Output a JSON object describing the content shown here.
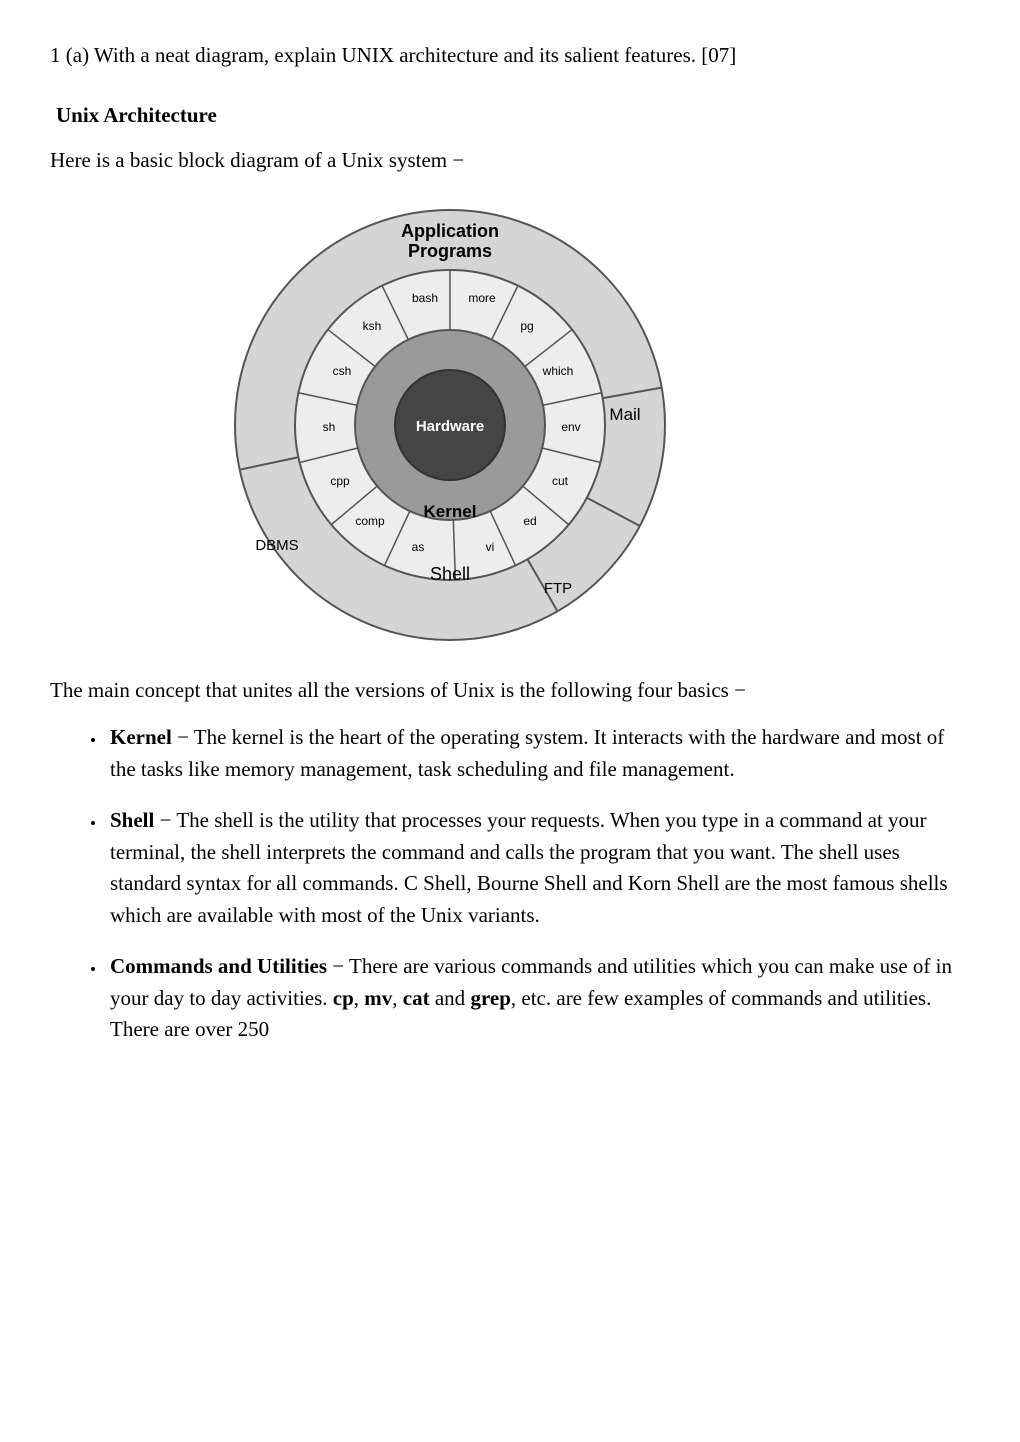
{
  "question": "1 (a) With a neat diagram, explain UNIX architecture and its salient features. [07]",
  "section_title": "Unix Architecture",
  "intro": "Here is a basic block diagram of a Unix system −",
  "diagram": {
    "outer_top": "Application",
    "outer_top2": "Programs",
    "outer_right": "Mail",
    "outer_left": "DBMS",
    "outer_bottom_right": "FTP",
    "shell_ring": "Shell",
    "kernel_ring": "Kernel",
    "core": "Hardware",
    "shells": {
      "bash": "bash",
      "more": "more",
      "pg": "pg",
      "ksh": "ksh",
      "csh": "csh",
      "which": "which",
      "sh": "sh",
      "env": "env",
      "cpp": "cpp",
      "cut": "cut",
      "comp": "comp",
      "ed": "ed",
      "as": "as",
      "vi": "vi"
    }
  },
  "main_concept": "The main concept that unites all the versions of Unix is the following four basics −",
  "bullets": {
    "kernel_label": "Kernel",
    "kernel_text": " − The kernel is the heart of the operating system. It interacts with the hardware and most of the tasks like memory management, task scheduling and file management.",
    "shell_label": "Shell",
    "shell_text": " − The shell is the utility that processes your requests. When you type in a command at your terminal, the shell interprets the command and calls the program that you want. The shell uses standard syntax for all commands. C Shell, Bourne Shell and Korn Shell are the most famous shells which are available with most of the Unix variants.",
    "cmd_label": "Commands and Utilities",
    "cmd_text1": " − There are various commands and utilities which you can make use of in your day to day activities. ",
    "cmd_cp": "cp",
    "cmd_sep1": ", ",
    "cmd_mv": "mv",
    "cmd_sep2": ", ",
    "cmd_cat": "cat",
    "cmd_text2": " and ",
    "cmd_grep": "grep",
    "cmd_text3": ", etc. are few examples of commands and utilities. There are over 250"
  }
}
